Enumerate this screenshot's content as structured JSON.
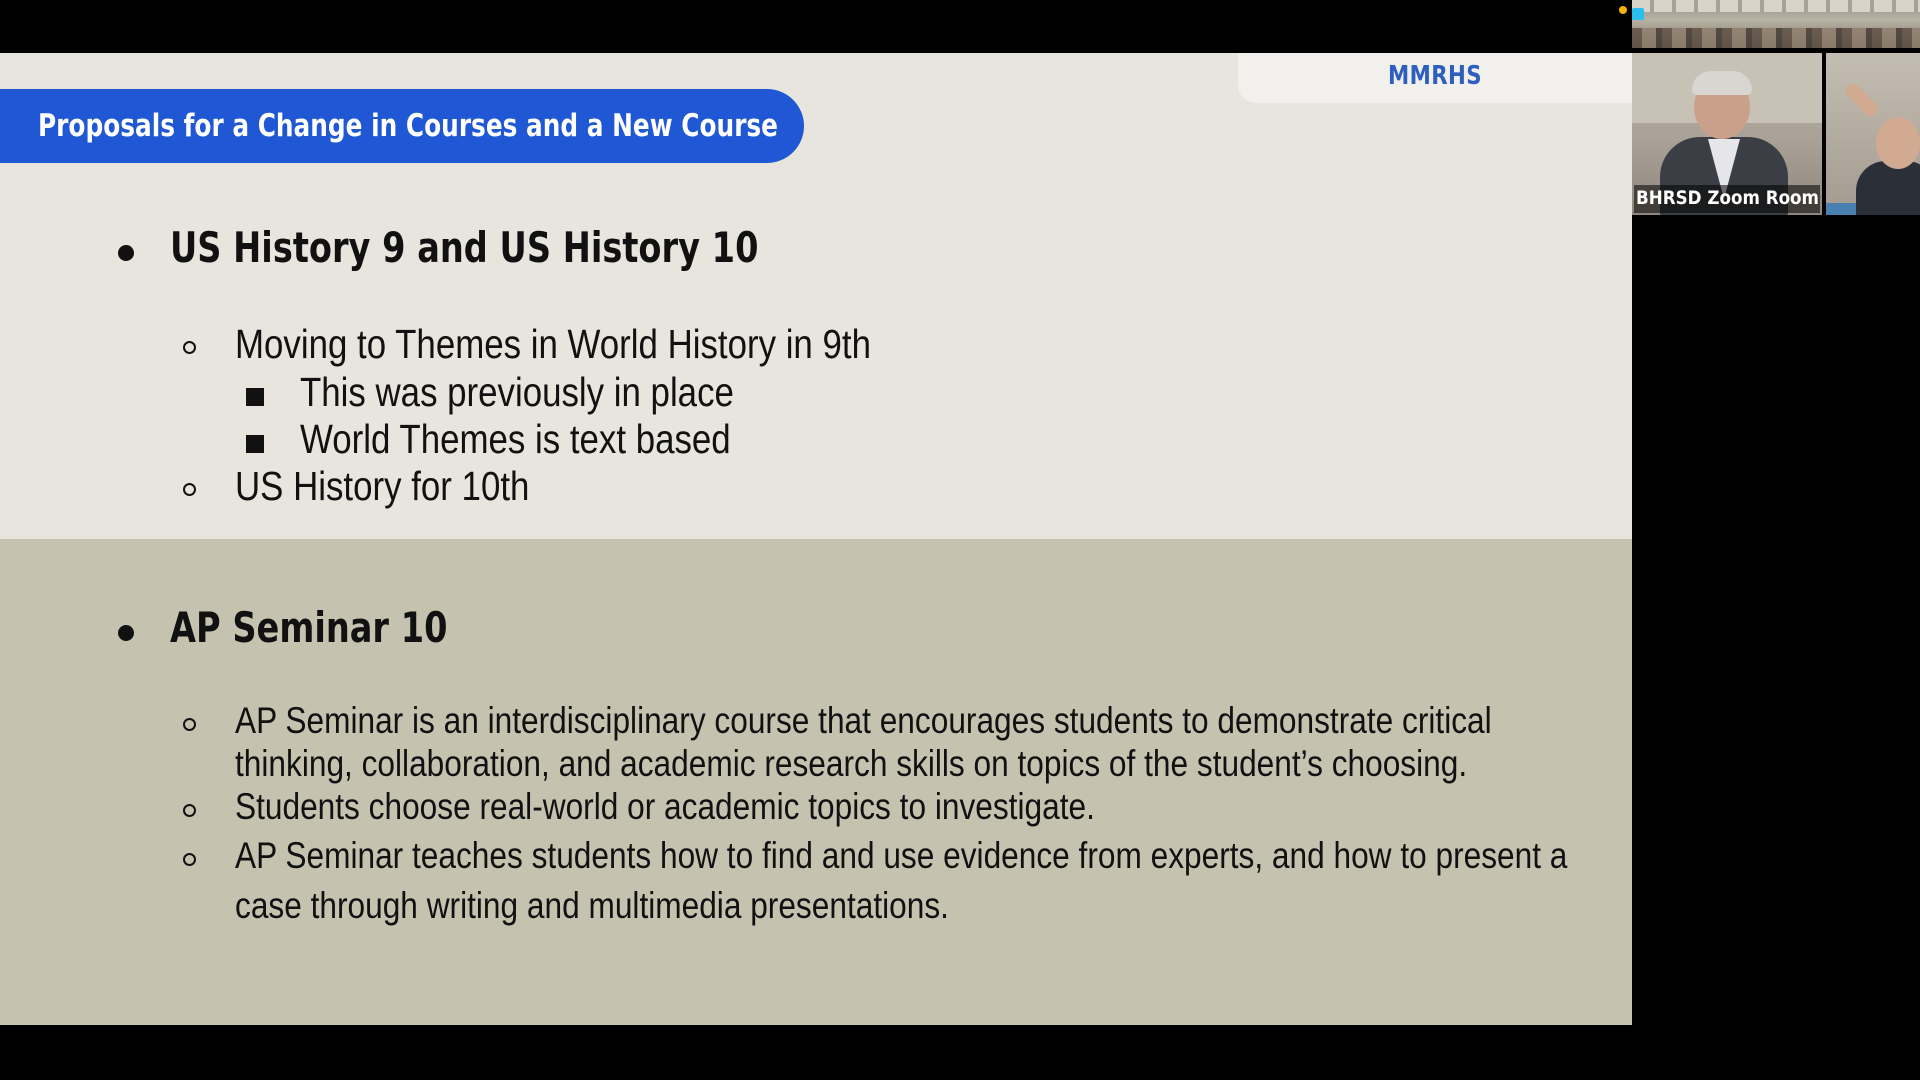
{
  "slide": {
    "logo": "MMRHS",
    "title": "Proposals for a Change in Courses and a New Course",
    "section1": {
      "heading": "US History 9 and US History 10",
      "items": [
        {
          "text": "Moving to Themes in World History in 9th",
          "subitems": [
            "This was previously in place",
            "World Themes is text based"
          ]
        },
        {
          "text": "US History for 10th"
        }
      ]
    },
    "section2": {
      "heading": "AP Seminar 10",
      "items": [
        {
          "lines": [
            "AP Seminar is an interdisciplinary course that encourages students to demonstrate critical",
            "thinking, collaboration, and academic research skills on topics of the student’s choosing."
          ]
        },
        {
          "lines": [
            "Students choose real-world or academic topics to investigate."
          ]
        },
        {
          "lines": [
            "AP Seminar teaches students how to find and use evidence from experts, and how to present a",
            "case through writing and multimedia presentations."
          ]
        }
      ]
    }
  },
  "video_panel": {
    "participants": [
      {
        "label": "BHRSD Zoom Room"
      }
    ]
  },
  "colors": {
    "title_bar": "#1f57d4",
    "logo_text": "#2e5fbf",
    "slide_top_bg": "#e7e5dd",
    "slide_bottom_bg": "#c5c3b0"
  }
}
